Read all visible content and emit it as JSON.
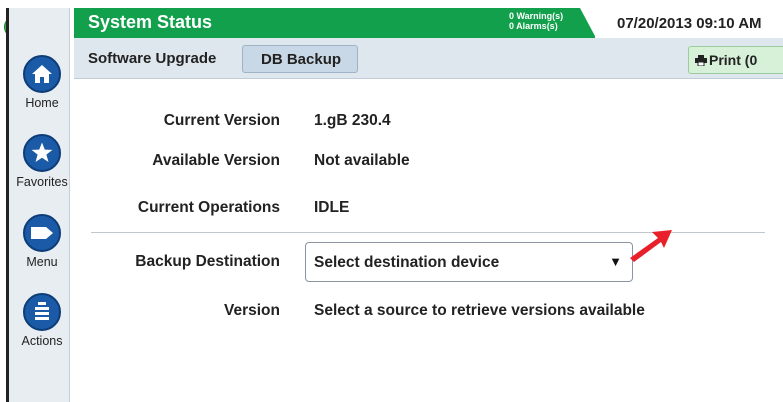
{
  "header": {
    "title": "System Status",
    "warnings": "0 Warning(s)",
    "alarms": "0 Alarms(s)",
    "datetime": "07/20/2013 09:10 AM"
  },
  "status_lights": [
    "green",
    "off",
    "off"
  ],
  "sidebar": {
    "items": [
      {
        "label": "Home",
        "icon": "home-icon"
      },
      {
        "label": "Favorites",
        "icon": "star-icon"
      },
      {
        "label": "Menu",
        "icon": "menu-tag-icon"
      },
      {
        "label": "Actions",
        "icon": "actions-list-icon"
      }
    ]
  },
  "breadcrumb": {
    "parent": "Software Upgrade",
    "current": "DB Backup",
    "print_label": "Print (0"
  },
  "details": {
    "current_version_label": "Current Version",
    "current_version_value": "1.gB 230.4",
    "available_version_label": "Available Version",
    "available_version_value": "Not available",
    "current_operations_label": "Current Operations",
    "current_operations_value": "IDLE",
    "backup_destination_label": "Backup Destination",
    "backup_destination_value": "Select destination device",
    "version_label": "Version",
    "version_value": "Select a source to retrieve versions available"
  },
  "colors": {
    "header_green": "#12a04c",
    "nav_blue": "#1b5aa6",
    "annotation_red": "#e8202a"
  }
}
